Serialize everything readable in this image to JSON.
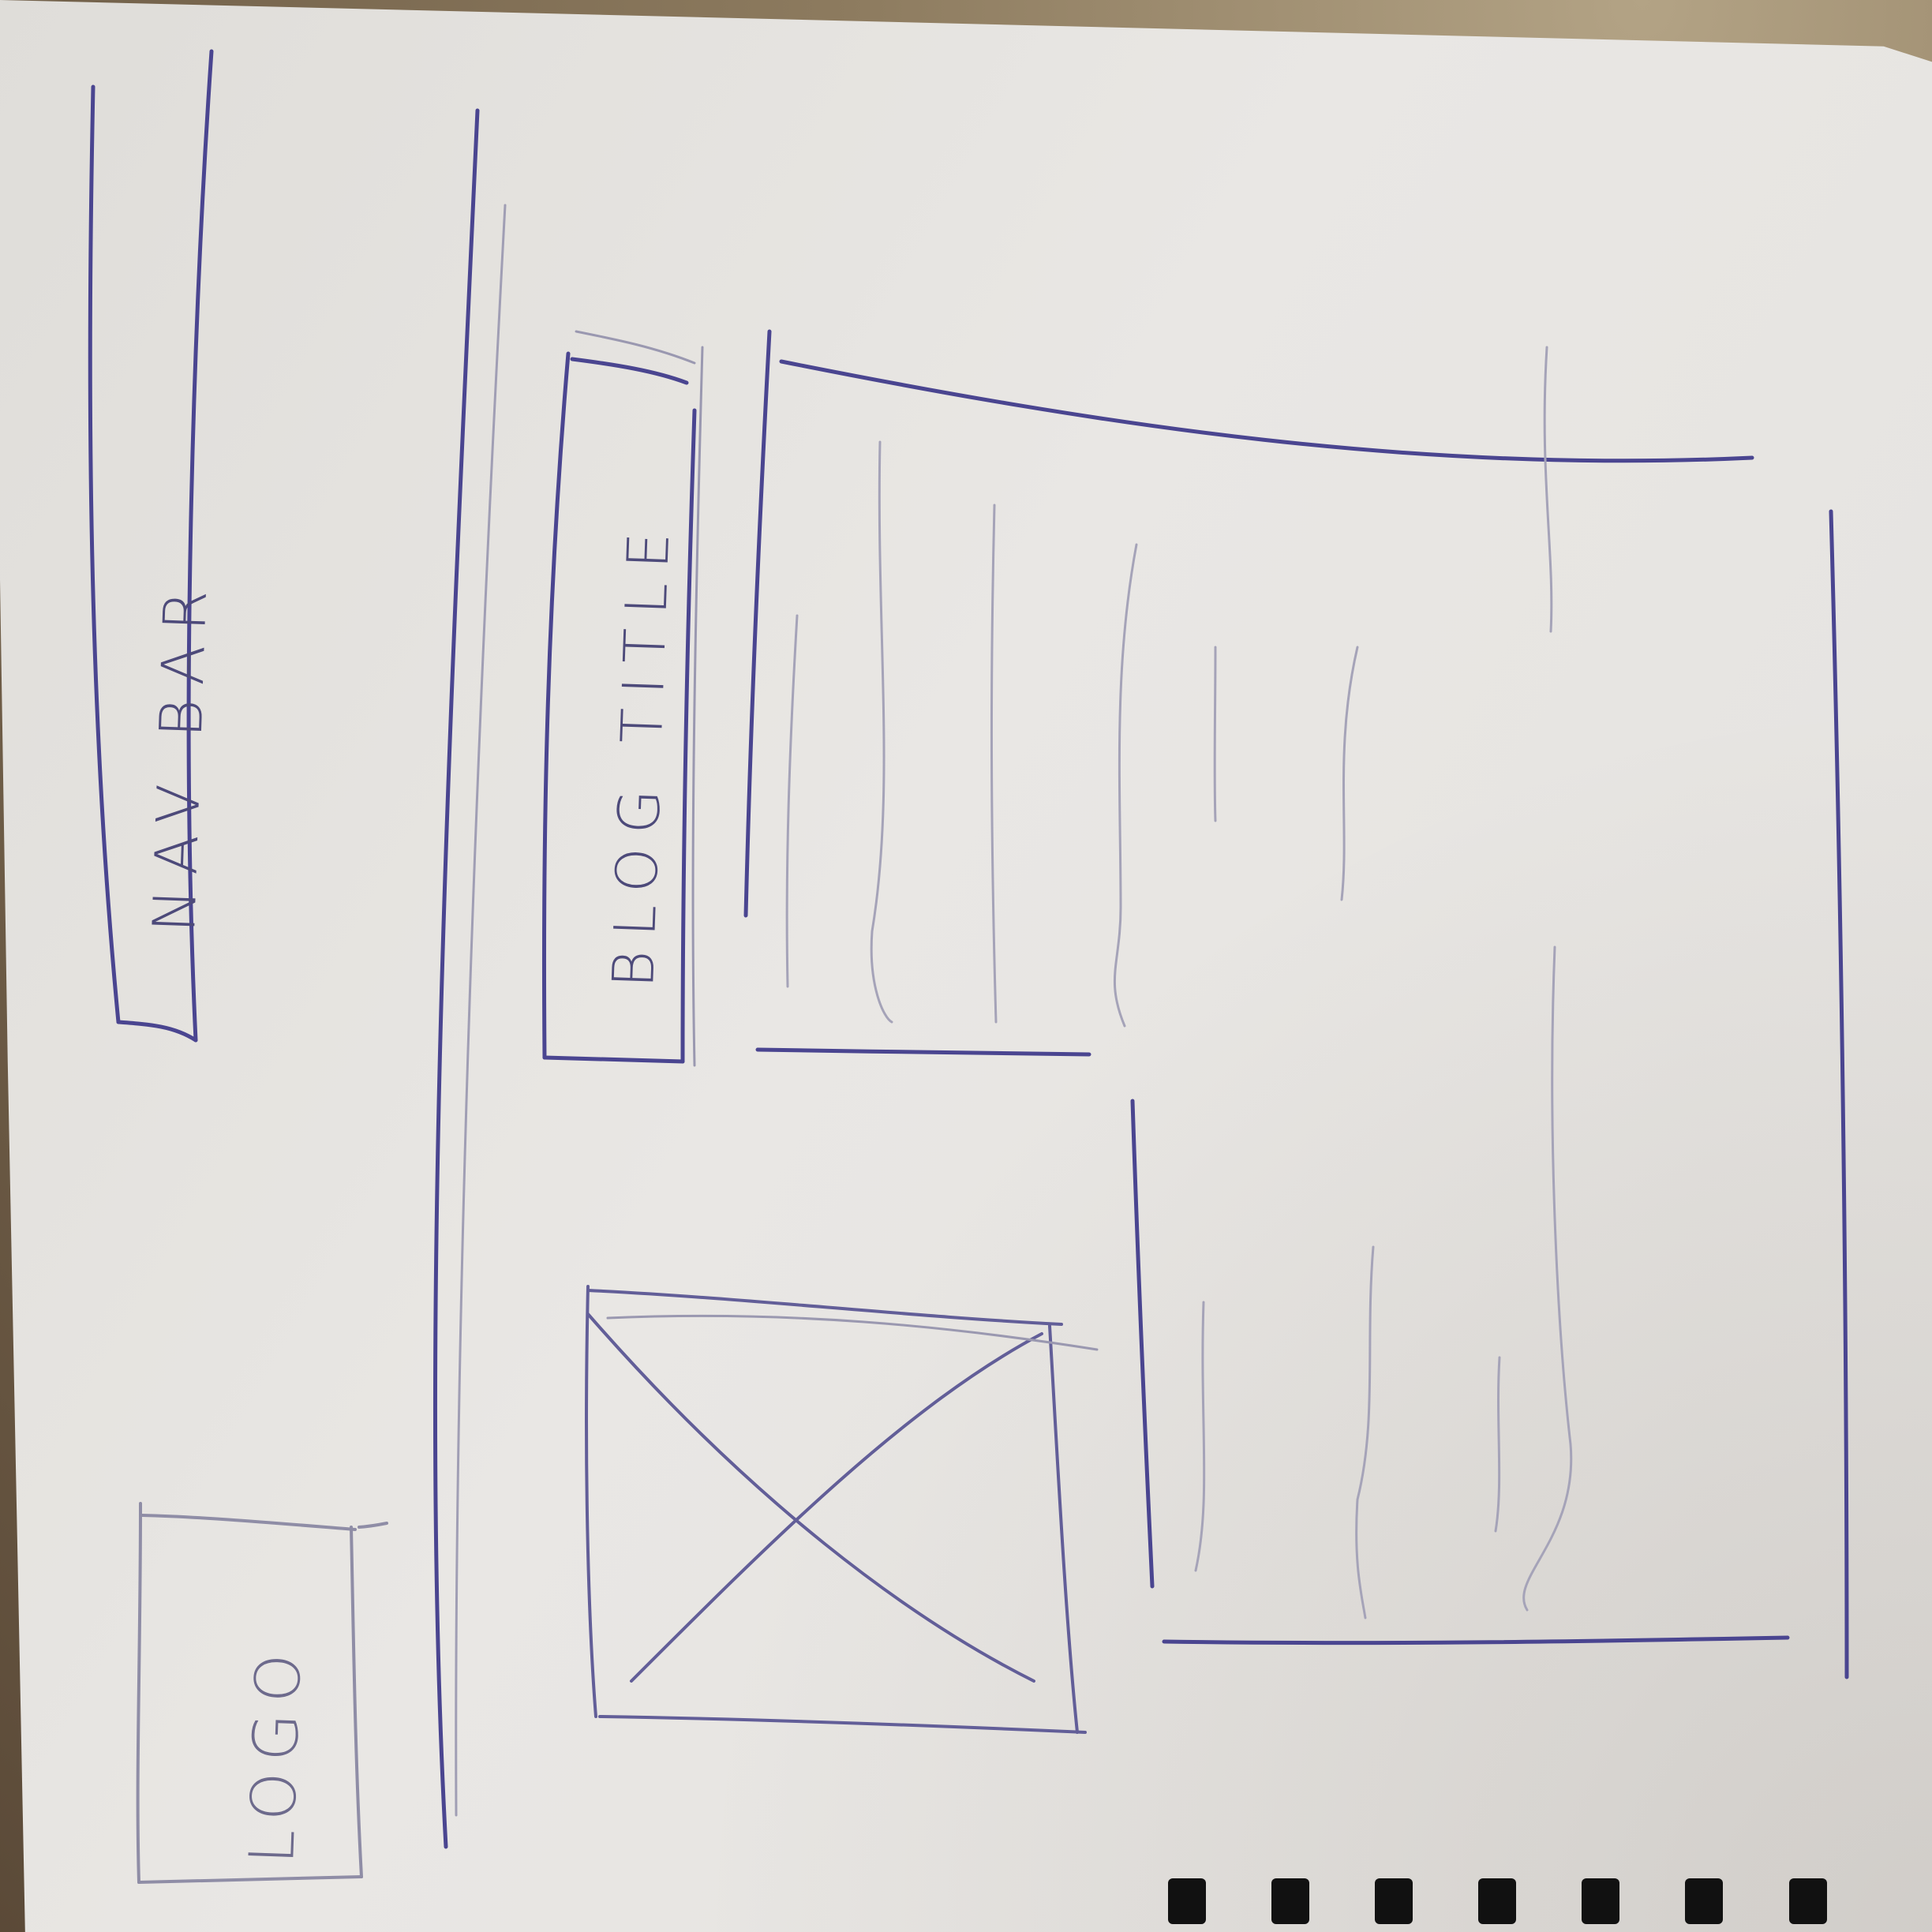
{
  "sketch": {
    "nav_bar_label": "NAV BAR",
    "blog_title_label": "BLOG TITLE",
    "logo_label": "LOGO"
  },
  "colors": {
    "pen_ink": "#3f3a8a",
    "pencil": "#8e8ca8",
    "paper": "#e6e4e1"
  },
  "icons": [
    "image-placeholder-icon"
  ]
}
